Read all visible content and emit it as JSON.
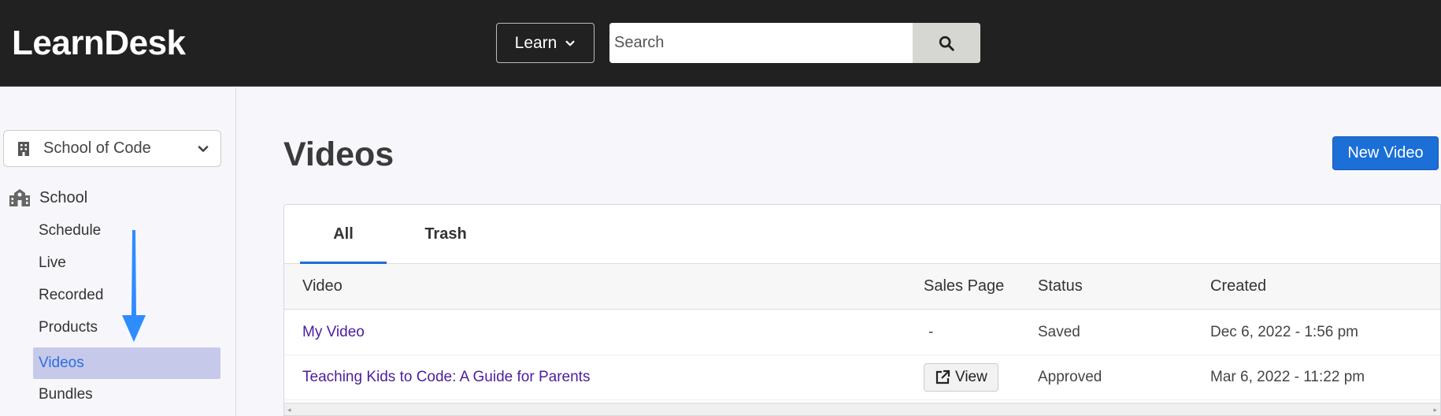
{
  "header": {
    "logo": "LearnDesk",
    "learn_label": "Learn",
    "search_placeholder": "Search"
  },
  "sidebar": {
    "school_select": "School of Code",
    "section": "School",
    "items": [
      {
        "label": "Schedule"
      },
      {
        "label": "Live"
      },
      {
        "label": "Recorded"
      },
      {
        "label": "Products"
      },
      {
        "label": "Videos",
        "active": true
      },
      {
        "label": "Bundles"
      }
    ]
  },
  "main": {
    "title": "Videos",
    "new_button": "New Video",
    "tabs": [
      {
        "label": "All",
        "active": true
      },
      {
        "label": "Trash"
      }
    ],
    "columns": [
      "Video",
      "Sales Page",
      "Status",
      "Created"
    ],
    "rows": [
      {
        "video": "My Video",
        "sales_page": "-",
        "status": "Saved",
        "created": "Dec 6, 2022 - 1:56 pm"
      },
      {
        "video": "Teaching Kids to Code: A Guide for Parents",
        "sales_page": "View",
        "status": "Approved",
        "created": "Mar 6, 2022 - 11:22 pm"
      }
    ]
  },
  "colors": {
    "topbar": "#212121",
    "accent": "#1b6fd6",
    "active_nav_bg": "#c7c9ea",
    "link": "#4b1d9e"
  },
  "icons": [
    "chevron-down-icon",
    "search-icon",
    "building-icon",
    "school-icon",
    "external-link-icon",
    "arrow-down-icon"
  ]
}
